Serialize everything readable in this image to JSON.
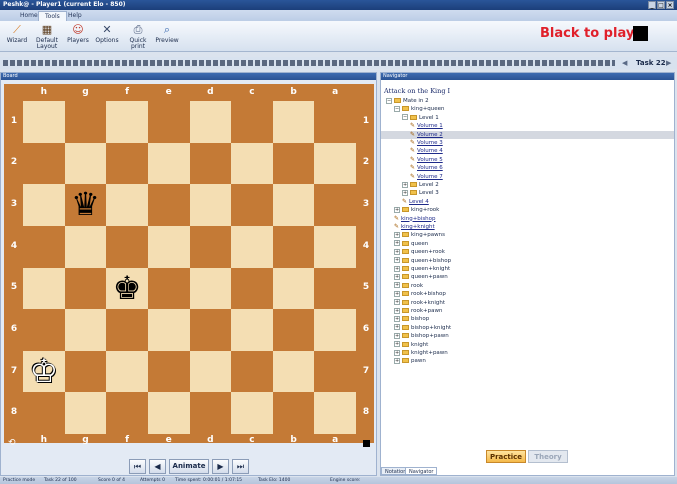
{
  "window": {
    "title": "Peshk@ - Player1 (current Elo - 850)",
    "minimize": "_",
    "maximize": "□",
    "close": "×"
  },
  "tabs": [
    {
      "label": "Home"
    },
    {
      "label": "Tools"
    },
    {
      "label": "Help"
    }
  ],
  "ribbon": [
    {
      "label": "Wizard",
      "icon": "wizard-icon"
    },
    {
      "label": "Default Layout",
      "icon": "layout-icon"
    },
    {
      "label": "Players",
      "icon": "players-icon"
    },
    {
      "label": "Options",
      "icon": "options-icon"
    },
    {
      "label": "Quick print",
      "icon": "print-icon"
    },
    {
      "label": "Preview",
      "icon": "preview-icon"
    }
  ],
  "status_to_move": "Black to play",
  "task": {
    "label": "Task 22"
  },
  "board": {
    "panel_title": "Board",
    "files": [
      "h",
      "g",
      "f",
      "e",
      "d",
      "c",
      "b",
      "a"
    ],
    "ranks": [
      "1",
      "2",
      "3",
      "4",
      "5",
      "6",
      "7",
      "8"
    ],
    "pieces": [
      {
        "glyph": "♛",
        "color": "black",
        "file": "g",
        "rank": "3"
      },
      {
        "glyph": "♚",
        "color": "black",
        "file": "f",
        "rank": "5"
      },
      {
        "glyph": "♔",
        "color": "white",
        "file": "h",
        "rank": "7"
      }
    ],
    "colors": {
      "light": "#f4deb3",
      "dark": "#c47a36",
      "frame": "#c47a36"
    }
  },
  "nav_controls": {
    "first": "⏮",
    "prev": "◀",
    "animate": "Animate",
    "next": "▶",
    "last": "⏭"
  },
  "navigator": {
    "panel_title": "Navigator",
    "heading": "Attack on the King I",
    "tree": [
      {
        "label": "Mate in 2",
        "type": "folder",
        "level": 0,
        "expander": "−"
      },
      {
        "label": "king+queen",
        "type": "folder",
        "level": 1,
        "expander": "−"
      },
      {
        "label": "Level 1",
        "type": "folder",
        "level": 2,
        "expander": "−"
      },
      {
        "label": "Volume 1",
        "type": "item",
        "level": 3
      },
      {
        "label": "Volume 2",
        "type": "item",
        "level": 3,
        "selected": true
      },
      {
        "label": "Volume 3",
        "type": "item",
        "level": 3
      },
      {
        "label": "Volume 4",
        "type": "item",
        "level": 3
      },
      {
        "label": "Volume 5",
        "type": "item",
        "level": 3
      },
      {
        "label": "Volume 6",
        "type": "item",
        "level": 3
      },
      {
        "label": "Volume 7",
        "type": "item",
        "level": 3
      },
      {
        "label": "Level 2",
        "type": "folder",
        "level": 2,
        "expander": "+"
      },
      {
        "label": "Level 3",
        "type": "folder",
        "level": 2,
        "expander": "+"
      },
      {
        "label": "Level 4",
        "type": "item",
        "level": 2
      },
      {
        "label": "king+rook",
        "type": "folder",
        "level": 1,
        "expander": "+"
      },
      {
        "label": "king+bishop",
        "type": "item",
        "level": 1
      },
      {
        "label": "king+knight",
        "type": "item",
        "level": 1
      },
      {
        "label": "king+pawns",
        "type": "folder",
        "level": 1,
        "expander": "+"
      },
      {
        "label": "queen",
        "type": "folder",
        "level": 1,
        "expander": "+"
      },
      {
        "label": "queen+rook",
        "type": "folder",
        "level": 1,
        "expander": "+"
      },
      {
        "label": "queen+bishop",
        "type": "folder",
        "level": 1,
        "expander": "+"
      },
      {
        "label": "queen+knight",
        "type": "folder",
        "level": 1,
        "expander": "+"
      },
      {
        "label": "queen+pawn",
        "type": "folder",
        "level": 1,
        "expander": "+"
      },
      {
        "label": "rook",
        "type": "folder",
        "level": 1,
        "expander": "+"
      },
      {
        "label": "rook+bishop",
        "type": "folder",
        "level": 1,
        "expander": "+"
      },
      {
        "label": "rook+knight",
        "type": "folder",
        "level": 1,
        "expander": "+"
      },
      {
        "label": "rook+pawn",
        "type": "folder",
        "level": 1,
        "expander": "+"
      },
      {
        "label": "bishop",
        "type": "folder",
        "level": 1,
        "expander": "+"
      },
      {
        "label": "bishop+knight",
        "type": "folder",
        "level": 1,
        "expander": "+"
      },
      {
        "label": "bishop+pawn",
        "type": "folder",
        "level": 1,
        "expander": "+"
      },
      {
        "label": "knight",
        "type": "folder",
        "level": 1,
        "expander": "+"
      },
      {
        "label": "knight+pawn",
        "type": "folder",
        "level": 1,
        "expander": "+"
      },
      {
        "label": "pawn",
        "type": "folder",
        "level": 1,
        "expander": "+"
      }
    ],
    "practice": "Practice",
    "theory": "Theory",
    "bottom_tabs": [
      "Notation",
      "Navigator"
    ]
  },
  "statusbar": [
    "Practice mode",
    "Task 22 of 100",
    "Score 0 of 4",
    "Attempts 0",
    "Time spent: 0:00:01 / 1:07:15",
    "Task Elo: 1400",
    "Engine score:"
  ]
}
